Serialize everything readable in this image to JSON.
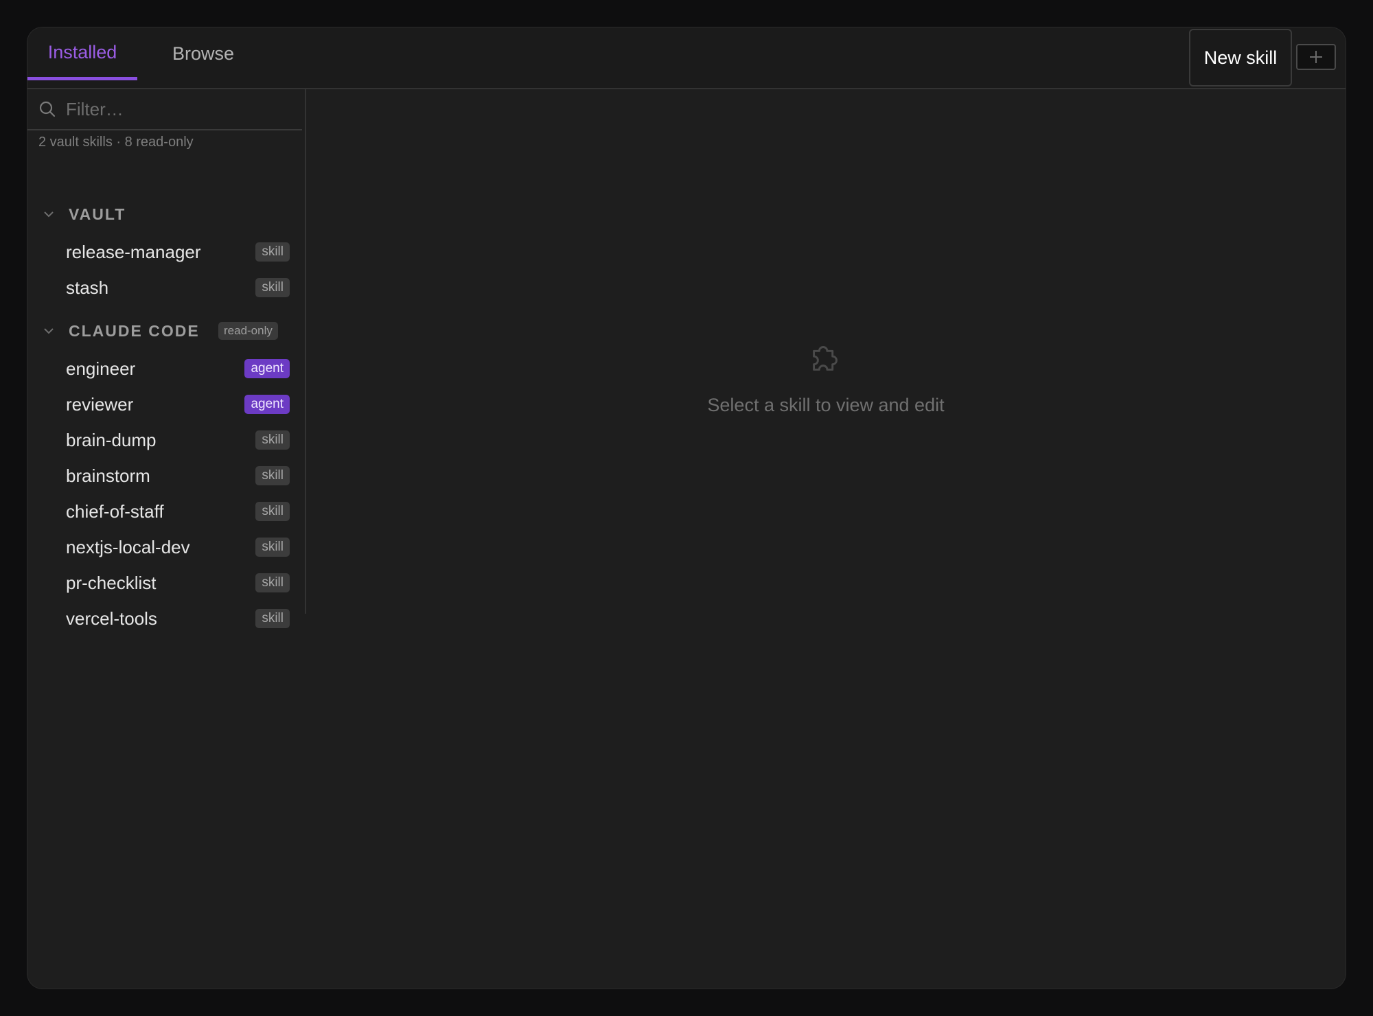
{
  "tabs": {
    "installed": "Installed",
    "browse": "Browse"
  },
  "toolbar": {
    "new_skill_label": "New skill"
  },
  "filter": {
    "placeholder": "Filter…"
  },
  "summary": "2 vault skills · 8 read-only",
  "sections": {
    "vault": {
      "title": "VAULT",
      "items": [
        {
          "label": "release-manager",
          "tag": "skill"
        },
        {
          "label": "stash",
          "tag": "skill"
        }
      ]
    },
    "claude_code": {
      "title": "CLAUDE CODE",
      "badge": "read-only",
      "items": [
        {
          "label": "engineer",
          "tag": "agent"
        },
        {
          "label": "reviewer",
          "tag": "agent"
        },
        {
          "label": "brain-dump",
          "tag": "skill"
        },
        {
          "label": "brainstorm",
          "tag": "skill"
        },
        {
          "label": "chief-of-staff",
          "tag": "skill"
        },
        {
          "label": "nextjs-local-dev",
          "tag": "skill"
        },
        {
          "label": "pr-checklist",
          "tag": "skill"
        },
        {
          "label": "vercel-tools",
          "tag": "skill"
        }
      ]
    }
  },
  "empty_state": {
    "icon": "puzzle-icon",
    "text": "Select a skill to view and edit"
  },
  "colors": {
    "accent": "#8a4fe0",
    "agent_badge": "#6c3bc4",
    "skill_badge": "#3c3c3c",
    "background": "#1e1e1e"
  }
}
